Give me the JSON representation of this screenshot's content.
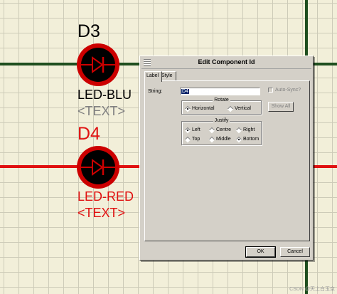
{
  "schematic": {
    "components": [
      {
        "ref": "D3",
        "value": "LED-BLU",
        "text": "<TEXT>",
        "ref_color": "#000000",
        "value_color": "#000000",
        "text_color": "#808080",
        "body_color": "#cc0000"
      },
      {
        "ref": "D4",
        "value": "LED-RED",
        "text": "<TEXT>",
        "ref_color": "#e01010",
        "value_color": "#e01010",
        "text_color": "#e01010",
        "body_color": "#cc0000"
      }
    ],
    "wire_color_dark": "#1f4f1f",
    "wire_color_red": "#e01010"
  },
  "dialog": {
    "title": "Edit Component Id",
    "tabs": [
      {
        "label": "Label",
        "active": true
      },
      {
        "label": "Style",
        "active": false
      }
    ],
    "string_label": "String:",
    "string_value": "D4",
    "auto_sync_label": "Auto-Sync?",
    "show_all_label": "Show All",
    "rotate": {
      "title": "Rotate",
      "options": [
        {
          "label": "Horizontal",
          "selected": true
        },
        {
          "label": "Vertical",
          "selected": false
        }
      ]
    },
    "justify": {
      "title": "Justify",
      "row1": [
        {
          "label": "Left",
          "selected": true
        },
        {
          "label": "Centre",
          "selected": false
        },
        {
          "label": "Right",
          "selected": false
        }
      ],
      "row2": [
        {
          "label": "Top",
          "selected": false
        },
        {
          "label": "Middle",
          "selected": false
        },
        {
          "label": "Bottom",
          "selected": true
        }
      ]
    },
    "ok_label": "OK",
    "cancel_label": "Cancel"
  },
  "watermark": "CSDN @天上白玉京"
}
